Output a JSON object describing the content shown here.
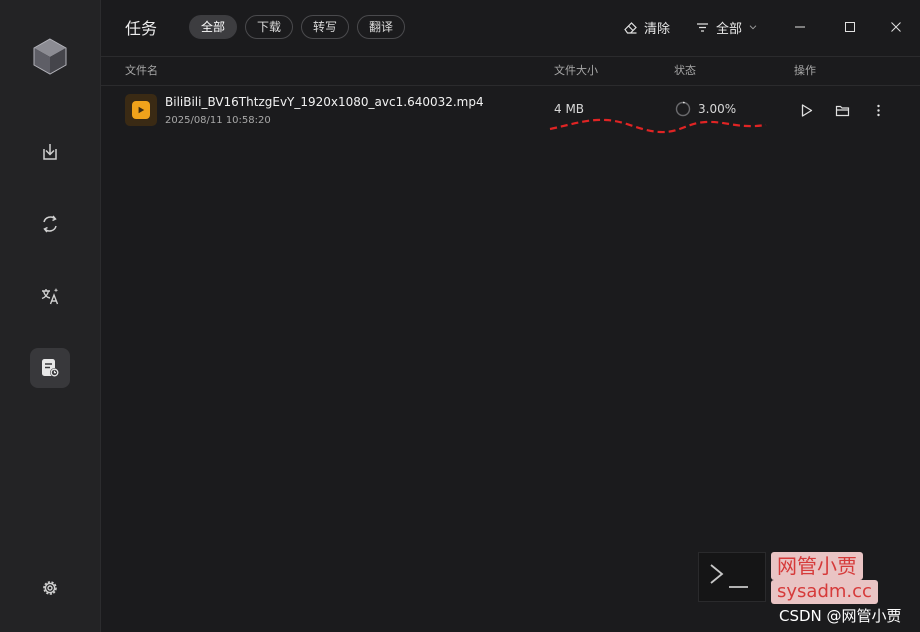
{
  "header": {
    "title": "任务",
    "filter_tabs": [
      {
        "label": "全部",
        "active": true
      },
      {
        "label": "下载",
        "active": false
      },
      {
        "label": "转写",
        "active": false
      },
      {
        "label": "翻译",
        "active": false
      }
    ],
    "clear_label": "清除",
    "filter_label": "全部"
  },
  "columns": {
    "name": "文件名",
    "size": "文件大小",
    "status": "状态",
    "actions": "操作"
  },
  "tasks": [
    {
      "file_name": "BiliBili_BV16ThtzgEvY_1920x1080_avc1.640032.mp4",
      "date": "2025/08/11 10:58:20",
      "size": "4 MB",
      "status": "3.00%",
      "progress_percent": 3
    }
  ],
  "watermarks": {
    "chinese": "网管小贾",
    "site": "sysadm.cc",
    "csdn": "CSDN @网管小贾"
  },
  "colors": {
    "accent_orange": "#f0a21b",
    "annotation_red": "#e02424",
    "background": "#1b1b1d",
    "sidebar": "#232325"
  },
  "icons": {
    "sidebar": [
      "cube-logo-icon",
      "download-icon",
      "convert-icon",
      "translate-icon",
      "task-list-icon",
      "settings-icon"
    ],
    "toolbar": [
      "eraser-icon",
      "filter-icon",
      "chevron-down-icon",
      "minimize-icon",
      "maximize-icon",
      "close-icon"
    ],
    "row": [
      "video-file-icon",
      "progress-spinner-icon",
      "play-icon",
      "folder-icon",
      "more-vertical-icon"
    ]
  }
}
